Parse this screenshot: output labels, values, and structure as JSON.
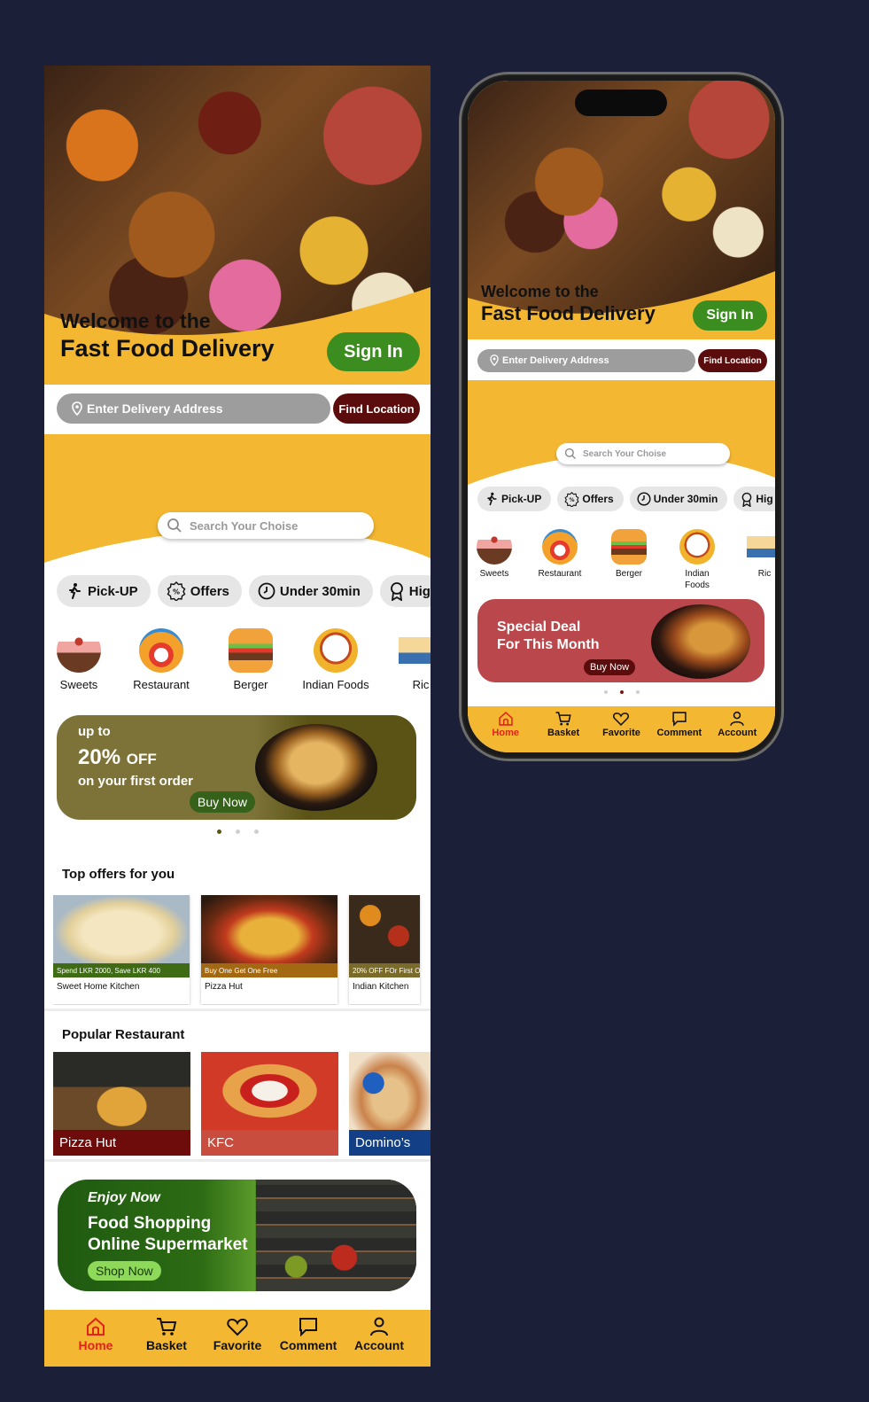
{
  "welcome": {
    "line1": "Welcome to the",
    "line2": "Fast Food Delivery",
    "signin": "Sign In"
  },
  "address": {
    "placeholder": "Enter Delivery Address",
    "find": "Find Location"
  },
  "search": {
    "placeholder": "Search Your Choise"
  },
  "chips": [
    {
      "label": "Pick-UP",
      "icon": "walking-person-icon"
    },
    {
      "label": "Offers",
      "icon": "percent-badge-icon"
    },
    {
      "label": "Under 30min",
      "icon": "clock-icon"
    },
    {
      "label": "Hig",
      "icon": "award-icon"
    }
  ],
  "categories": [
    {
      "label": "Sweets"
    },
    {
      "label": "Restaurant"
    },
    {
      "label": "Berger"
    },
    {
      "label": "Indian Foods"
    },
    {
      "label": "Ric"
    }
  ],
  "promo": {
    "upto": "up to",
    "percent": "20%",
    "off": "OFF",
    "first": "on your first order",
    "buy": "Buy Now"
  },
  "top_offers": {
    "title": "Top offers for you",
    "items": [
      {
        "strip": "Spend LKR 2000, Save LKR 400",
        "name": "Sweet Home Kitchen",
        "color": "#3f6b14"
      },
      {
        "strip": "Buy One Get One Free",
        "name": "Pizza Hut",
        "color": "#a26912"
      },
      {
        "strip": "20% OFF FOr First O",
        "name": "Indian Kitchen",
        "color": "#7a6b2a"
      }
    ]
  },
  "popular": {
    "title": "Popular Restaurant",
    "items": [
      {
        "name": "Pizza Hut",
        "color": "#6e0b0b"
      },
      {
        "name": "KFC",
        "color": "#c94d3e"
      },
      {
        "name": "Domino’s",
        "color": "#123f86"
      }
    ]
  },
  "market": {
    "enjoy": "Enjoy Now",
    "line1": "Food Shopping",
    "line2": "Online Supermarket",
    "shop": "Shop Now"
  },
  "tabs": [
    {
      "label": "Home",
      "icon": "home-icon",
      "active": true
    },
    {
      "label": "Basket",
      "icon": "cart-icon"
    },
    {
      "label": "Favorite",
      "icon": "heart-icon"
    },
    {
      "label": "Comment",
      "icon": "comment-icon"
    },
    {
      "label": "Account",
      "icon": "user-icon"
    }
  ],
  "phone": {
    "deal_line1": "Special Deal",
    "deal_line2": "For This Month",
    "deal_buy": "Buy Now",
    "categories": [
      {
        "label": "Sweets"
      },
      {
        "label": "Restaurant"
      },
      {
        "label": "Berger"
      },
      {
        "label": "Indian Foods"
      },
      {
        "label": "Ric"
      }
    ]
  },
  "colors": {
    "brand_yellow": "#f3b731",
    "signin_green": "#3a8d1e",
    "maroon": "#5b0c0c",
    "active_tab": "#e3231b",
    "background": "#1b1f38"
  }
}
